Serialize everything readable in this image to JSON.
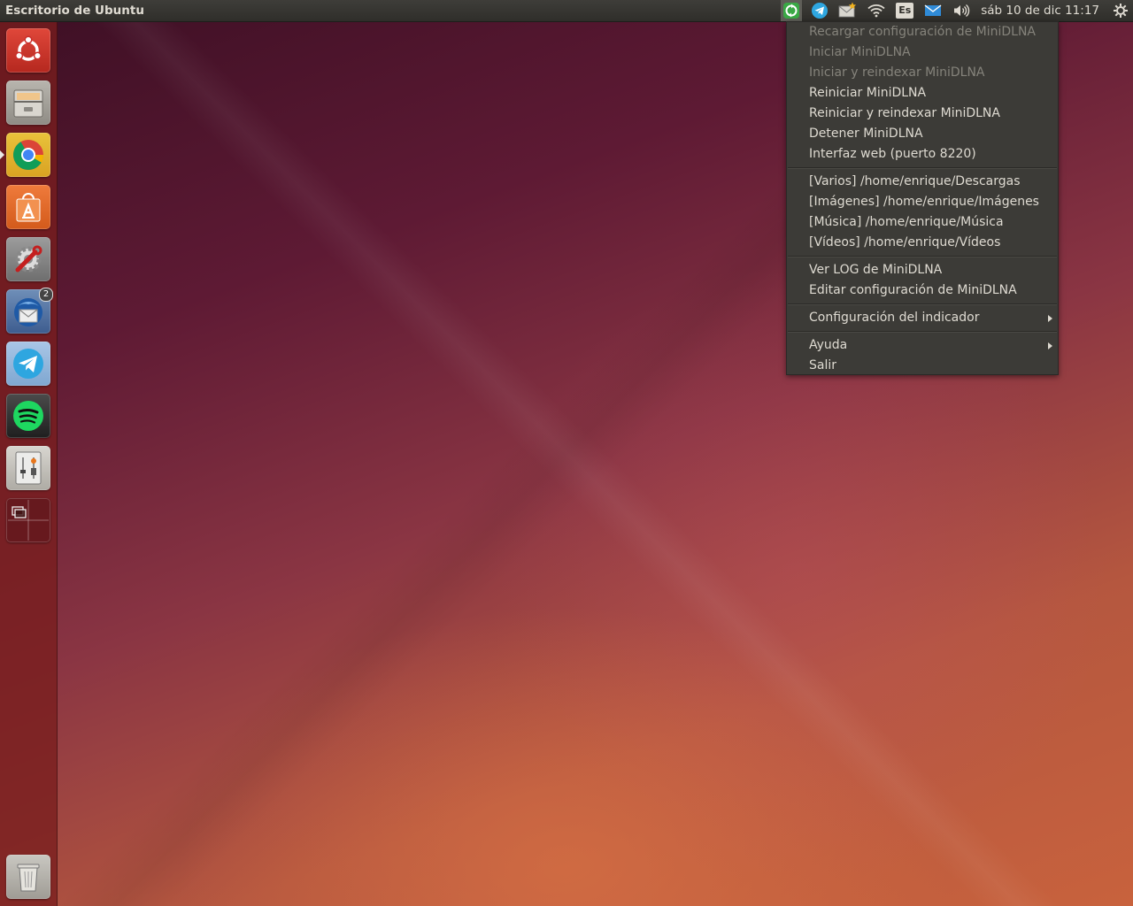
{
  "topbar": {
    "title": "Escritorio de Ubuntu",
    "keyboard_layout": "Es",
    "clock": "sáb 10 de dic 11:17"
  },
  "launcher": {
    "items": [
      {
        "name": "ubuntu-dash",
        "icon": "ubuntu-logo-icon"
      },
      {
        "name": "files",
        "icon": "file-cabinet-icon"
      },
      {
        "name": "chrome",
        "icon": "chrome-icon"
      },
      {
        "name": "software-center",
        "icon": "shopping-bag-icon"
      },
      {
        "name": "system-settings",
        "icon": "settings-wrench-icon"
      },
      {
        "name": "thunderbird",
        "icon": "thunderbird-icon",
        "badge": "2"
      },
      {
        "name": "telegram",
        "icon": "telegram-icon"
      },
      {
        "name": "spotify",
        "icon": "spotify-icon"
      },
      {
        "name": "sound-mixer",
        "icon": "mixer-icon"
      },
      {
        "name": "workspace-switcher",
        "icon": "workspace-icon"
      },
      {
        "name": "trash",
        "icon": "trash-icon"
      }
    ]
  },
  "menu": {
    "items": [
      {
        "label": "Recargar configuración de MiniDLNA",
        "disabled": true
      },
      {
        "label": "Iniciar MiniDLNA",
        "disabled": true
      },
      {
        "label": "Iniciar y reindexar MiniDLNA",
        "disabled": true
      },
      {
        "label": "Reiniciar MiniDLNA"
      },
      {
        "label": "Reiniciar y reindexar MiniDLNA"
      },
      {
        "label": "Detener MiniDLNA"
      },
      {
        "label": "Interfaz web (puerto 8220)"
      },
      {
        "label": "[Varios] /home/enrique/Descargas"
      },
      {
        "label": "[Imágenes] /home/enrique/Imágenes"
      },
      {
        "label": "[Música] /home/enrique/Música"
      },
      {
        "label": "[Vídeos] /home/enrique/Vídeos"
      },
      {
        "label": "Ver LOG de MiniDLNA"
      },
      {
        "label": "Editar configuración de MiniDLNA"
      },
      {
        "label": "Configuración del indicador",
        "submenu": true
      },
      {
        "label": "Ayuda",
        "submenu": true
      },
      {
        "label": "Salir"
      }
    ]
  }
}
